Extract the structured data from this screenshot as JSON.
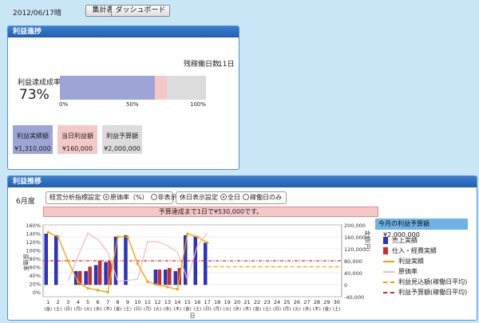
{
  "header": {
    "date": "2012/06/17晴",
    "summary_btn": "集計表",
    "dashboard_btn": "ダッシュボード"
  },
  "progress": {
    "title": "利益進捗",
    "remaining_label": "残稼働日数",
    "remaining_value": "11日",
    "rate_label": "利益達成成率",
    "rate_value": "73%",
    "bar_fill": 0.65,
    "bar_overlay": 0.08,
    "ticks": [
      "0%",
      "50%",
      "100%"
    ],
    "tiles": [
      {
        "label": "利益実績額",
        "value": "¥1,310,000",
        "color": "#9ea5d6"
      },
      {
        "label": "当日利益額",
        "value": "¥160,000",
        "color": "#f5c8c8"
      },
      {
        "label": "利益予算額",
        "value": "¥2,000,000",
        "color": "#dcdcdc"
      }
    ]
  },
  "trend": {
    "title": "利益推移",
    "month": "6月度",
    "analysis_label": "経営分析指標設定",
    "analysis_opt1": "原価率（%）",
    "analysis_opt2": "非表示",
    "holiday_label": "休日表示設定",
    "holiday_opt1": "全日",
    "holiday_opt2": "稼働日のみ",
    "banner": "予算達成まで1日で¥530,000です。",
    "budget_label": "今月の利益予算額",
    "budget_value": "¥2,000,000",
    "legend": [
      {
        "label": "売上実績",
        "type": "bar",
        "color": "#2a32c8"
      },
      {
        "label": "仕入・経費実績",
        "type": "bar",
        "color": "#d42a2a"
      },
      {
        "label": "利益実績",
        "type": "linedot",
        "color": "#f5a000"
      },
      {
        "label": "原価率",
        "type": "line",
        "color": "#f5b8b8"
      },
      {
        "label": "利益見込額(稼働日平均)",
        "type": "dash",
        "color": "#f5a000"
      },
      {
        "label": "利益予算額(稼働日平均)",
        "type": "dashdot",
        "color": "#d42a2a"
      }
    ]
  },
  "chart_data": {
    "type": "bar",
    "ylabel_left": "原価率",
    "ylabel_right": "金額(円)",
    "xlabel": "日",
    "left_ticks": [
      "160%",
      "140%",
      "120%",
      "100%",
      "80%",
      "60%",
      "40%",
      "20%",
      "0%"
    ],
    "right_ticks": [
      "200,000",
      "160,000",
      "120,000",
      "80,000",
      "40,000",
      "0",
      "-40,000"
    ],
    "ylim_right": [
      -40000,
      200000
    ],
    "days": [
      {
        "d": "1",
        "w": "(金)",
        "sales": 170000,
        "cost": 0,
        "profit": 175000,
        "rate": null
      },
      {
        "d": "2",
        "w": "(土)",
        "sales": 165000,
        "cost": 0,
        "profit": 160000,
        "rate": null
      },
      {
        "d": "3",
        "w": "(日)",
        "sales": 0,
        "cost": 0,
        "profit": 80000,
        "rate": 25
      },
      {
        "d": "4",
        "w": "(月)",
        "sales": 45000,
        "cost": 45000,
        "profit": 10000,
        "rate": 85
      },
      {
        "d": "5",
        "w": "(火)",
        "sales": 45000,
        "cost": 60000,
        "profit": -12000,
        "rate": 140
      },
      {
        "d": "6",
        "w": "(水)",
        "sales": 65000,
        "cost": 80000,
        "profit": -18000,
        "rate": 125
      },
      {
        "d": "7",
        "w": "(木)",
        "sales": 75000,
        "cost": 80000,
        "profit": -25000,
        "rate": 95
      },
      {
        "d": "8",
        "w": "(金)",
        "sales": 160000,
        "cost": 0,
        "profit": 160000,
        "rate": 25
      },
      {
        "d": "9",
        "w": "(土)",
        "sales": 165000,
        "cost": 0,
        "profit": 160000,
        "rate": null
      },
      {
        "d": "10",
        "w": "(日)",
        "sales": 0,
        "cost": 0,
        "profit": 70000,
        "rate": 30
      },
      {
        "d": "11",
        "w": "(月)",
        "sales": 0,
        "cost": 0,
        "profit": 10000,
        "rate": 120
      },
      {
        "d": "12",
        "w": "(火)",
        "sales": 50000,
        "cost": 50000,
        "profit": 0,
        "rate": 120
      },
      {
        "d": "13",
        "w": "(水)",
        "sales": 50000,
        "cost": 55000,
        "profit": -8000,
        "rate": 110
      },
      {
        "d": "14",
        "w": "(木)",
        "sales": 45000,
        "cost": 55000,
        "profit": -15000,
        "rate": 95
      },
      {
        "d": "15",
        "w": "(金)",
        "sales": 165000,
        "cost": 0,
        "profit": 170000,
        "rate": 30
      },
      {
        "d": "16",
        "w": "(土)",
        "sales": 160000,
        "cost": 0,
        "profit": 160000,
        "rate": 110
      },
      {
        "d": "17",
        "w": "(日)",
        "sales": 140000,
        "cost": 0,
        "profit": 140000,
        "rate": 140
      },
      {
        "d": "18",
        "w": "(月)"
      },
      {
        "d": "19",
        "w": "(火)"
      },
      {
        "d": "20",
        "w": "(水)"
      },
      {
        "d": "21",
        "w": "(木)"
      },
      {
        "d": "22",
        "w": "(金)"
      },
      {
        "d": "23",
        "w": "(土)"
      },
      {
        "d": "24",
        "w": "(日)"
      },
      {
        "d": "25",
        "w": "(月)"
      },
      {
        "d": "26",
        "w": "(火)"
      },
      {
        "d": "27",
        "w": "(水)"
      },
      {
        "d": "28",
        "w": "(木)"
      },
      {
        "d": "29",
        "w": "(金)"
      },
      {
        "d": "30",
        "w": "(土)"
      }
    ],
    "budget_avg": 80000,
    "forecast_avg": 60000
  }
}
